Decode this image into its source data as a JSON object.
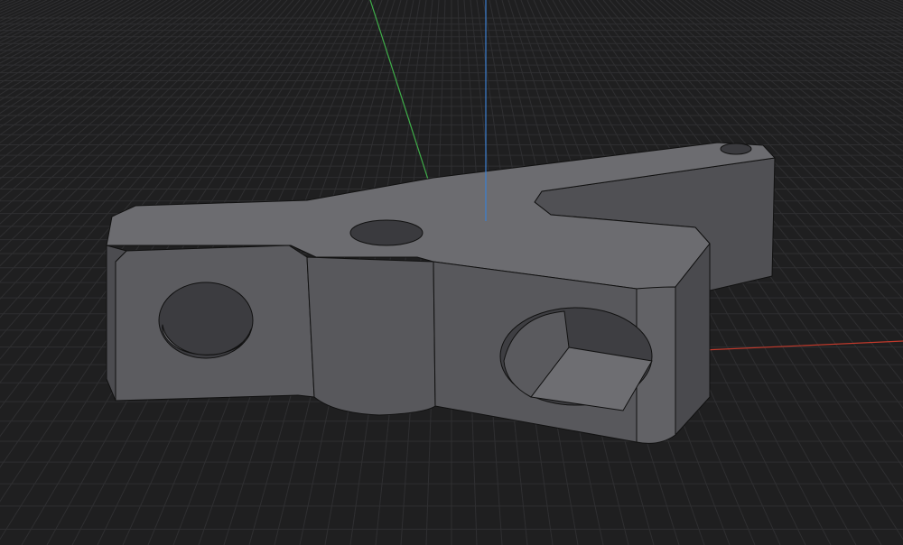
{
  "viewport": {
    "background_color": "#1f1f20",
    "grid_color": "#2f2f31",
    "axes": {
      "x_color": "#c0392b",
      "y_color": "#3fae49",
      "z_color": "#3b7fd0"
    },
    "model": {
      "top_color": "#6c6c70",
      "front_color": "#5a5a5e",
      "side_color": "#4a4a4e",
      "edge_color": "#111111"
    }
  }
}
